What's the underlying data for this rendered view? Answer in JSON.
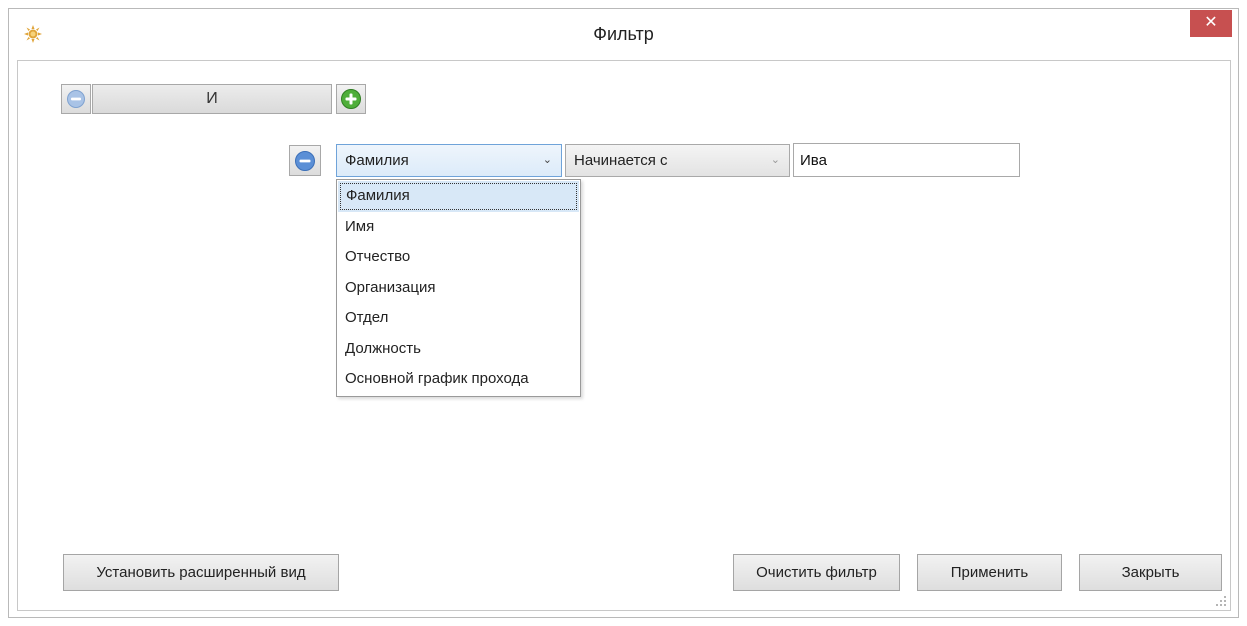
{
  "window": {
    "title": "Фильтр",
    "close_symbol": "✕"
  },
  "filter": {
    "logic_label": "И",
    "condition": {
      "field_value": "Фамилия",
      "operator_value": "Начинается с",
      "text_value": "Ива"
    },
    "field_options": [
      "Фамилия",
      "Имя",
      "Отчество",
      "Организация",
      "Отдел",
      "Должность",
      "Основной график прохода"
    ]
  },
  "buttons": {
    "advanced_view": "Установить расширенный вид",
    "clear_filter": "Очистить фильтр",
    "apply": "Применить",
    "close": "Закрыть"
  },
  "icons": {
    "app": "app-sun-icon",
    "remove": "minus-circle-icon",
    "add": "plus-circle-icon",
    "dropdown": "chevron-down-icon",
    "resize": "resize-grip-icon"
  },
  "colors": {
    "close_button": "#c75050",
    "remove_icon": "#5b8fd6",
    "add_icon": "#3f9a2f",
    "selection": "#d8e8f7"
  }
}
